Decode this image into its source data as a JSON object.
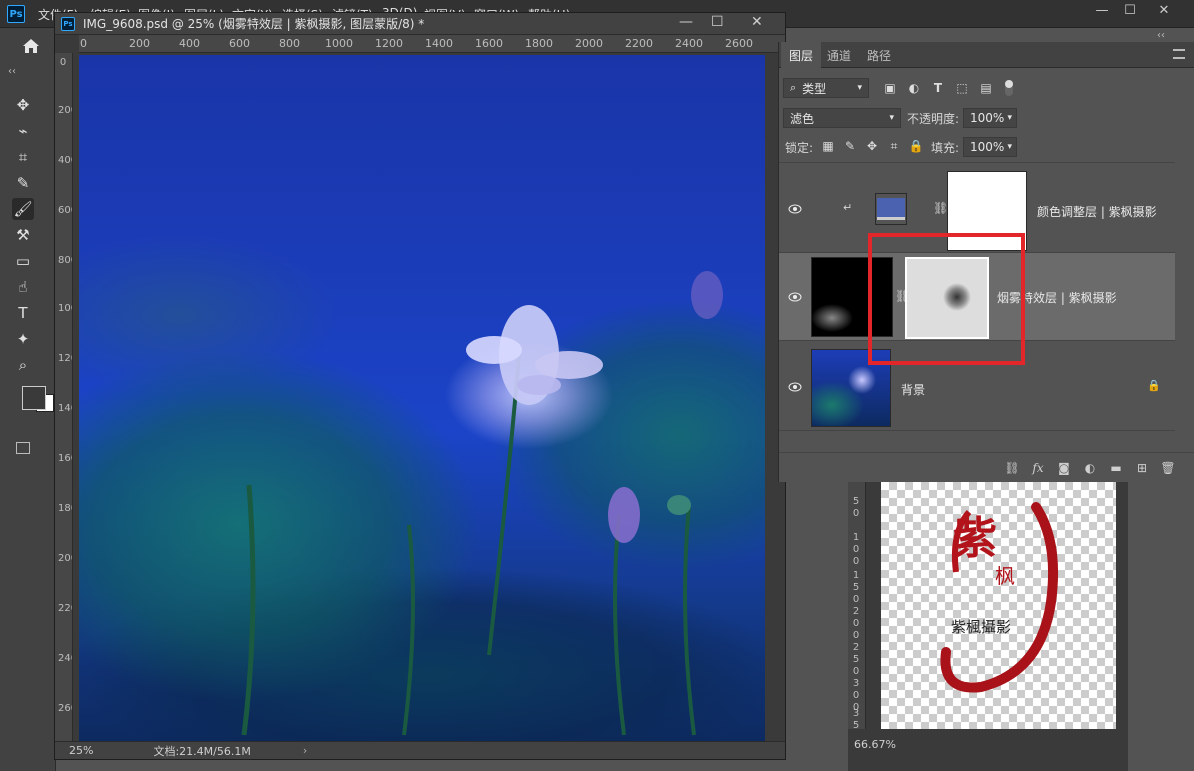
{
  "app": {
    "logo": "Ps",
    "menu": [
      "文件(F)",
      "编辑(E)",
      "图像(I)",
      "图层(L)",
      "文字(Y)",
      "选择(S)",
      "滤镜(T)",
      "3D(D)",
      "视图(V)",
      "窗口(W)",
      "帮助(H)"
    ],
    "window_controls": {
      "minimize": "—",
      "maximize": "☐",
      "close": "✕"
    }
  },
  "toolbar": {
    "collapse": "‹‹",
    "tools": [
      {
        "name": "move-tool",
        "glyph": "✥"
      },
      {
        "name": "lasso-tool",
        "glyph": "⌁"
      },
      {
        "name": "crop-tool",
        "glyph": "⌗"
      },
      {
        "name": "eyedropper-tool",
        "glyph": "✎"
      },
      {
        "name": "brush-tool",
        "glyph": "🖌"
      },
      {
        "name": "clone-stamp-tool",
        "glyph": "⚒"
      },
      {
        "name": "gradient-tool",
        "glyph": "▭"
      },
      {
        "name": "smudge-tool",
        "glyph": "☝"
      },
      {
        "name": "type-tool",
        "glyph": "T"
      },
      {
        "name": "shape-tool",
        "glyph": "✦"
      },
      {
        "name": "zoom-tool",
        "glyph": "⌕"
      }
    ],
    "foreground_color": "#3a3a3a",
    "background_color": "#ffffff"
  },
  "document": {
    "title": "IMG_9608.psd @ 25% (烟雾特效层 | 紫枫摄影, 图层蒙版/8) *",
    "ruler_h": [
      "0",
      "200",
      "400",
      "600",
      "800",
      "1000",
      "1200",
      "1400",
      "1600",
      "1800",
      "2000",
      "2200",
      "2400",
      "2600"
    ],
    "ruler_v": [
      "0",
      "200",
      "400",
      "600",
      "800",
      "1000",
      "1200",
      "1400",
      "1600",
      "1800",
      "2000",
      "2200",
      "2400",
      "2600"
    ],
    "zoom": "25%",
    "doc_info": "文档:21.4M/56.1M",
    "arrow": "›"
  },
  "layers_panel": {
    "tabs": [
      "图层",
      "通道",
      "路径"
    ],
    "active_tab": 0,
    "filter_kind": "类型",
    "blend_mode": "滤色",
    "opacity_label": "不透明度:",
    "opacity_value": "100%",
    "lock_label": "锁定:",
    "fill_label": "填充:",
    "fill_value": "100%",
    "layers": [
      {
        "name": "颜色调整层 | 紫枫摄影",
        "visible": true,
        "clipped": true,
        "selected": false
      },
      {
        "name": "烟雾特效层 | 紫枫摄影",
        "visible": true,
        "clipped": false,
        "selected": true
      },
      {
        "name": "背景",
        "visible": true,
        "clipped": false,
        "selected": false,
        "locked": true
      }
    ],
    "footer_icons": [
      "link-icon",
      "fx-icon",
      "mask-icon",
      "adjustment-icon",
      "folder-icon",
      "new-layer-icon",
      "trash-icon"
    ],
    "fx_label": "fx"
  },
  "navigator": {
    "zoom": "66.67%",
    "ruler_v": [
      "5 0",
      "1 0 0",
      "1 5 0",
      "2 0 0",
      "2 5 0",
      "3 0 0",
      "3 5 0"
    ],
    "logo_text": "紫楓攝影",
    "logo_big": "紫",
    "logo_small": "枫",
    "logo_color": "#b3141b"
  },
  "highlight_color": "#e2262a"
}
